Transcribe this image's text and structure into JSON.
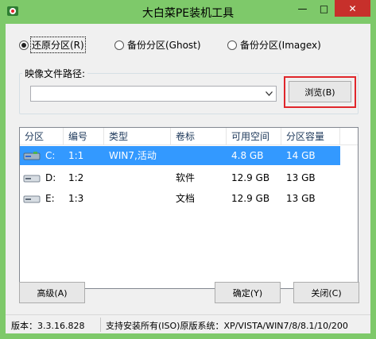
{
  "window": {
    "title": "大白菜PE装机工具",
    "controls": {
      "minimize": "—",
      "maximize": "□",
      "close": "✕"
    }
  },
  "modes": [
    {
      "label": "还原分区(R)",
      "selected": true
    },
    {
      "label": "备份分区(Ghost)",
      "selected": false
    },
    {
      "label": "备份分区(Imagex)",
      "selected": false
    }
  ],
  "image_path": {
    "group_label": "映像文件路径:",
    "value": "",
    "browse_label": "浏览(B)"
  },
  "table": {
    "headers": [
      "分区",
      "编号",
      "类型",
      "卷标",
      "可用空间",
      "分区容量"
    ],
    "rows": [
      {
        "partition": "C:",
        "number": "1:1",
        "type": "WIN7,活动",
        "label": "",
        "free": "4.8 GB",
        "capacity": "14 GB",
        "selected": true
      },
      {
        "partition": "D:",
        "number": "1:2",
        "type": "",
        "label": "软件",
        "free": "12.9 GB",
        "capacity": "13 GB",
        "selected": false
      },
      {
        "partition": "E:",
        "number": "1:3",
        "type": "",
        "label": "文档",
        "free": "12.9 GB",
        "capacity": "13 GB",
        "selected": false
      }
    ]
  },
  "buttons": {
    "advanced": "高级(A)",
    "ok": "确定(Y)",
    "close": "关闭(C)"
  },
  "status": {
    "version": "版本：3.3.16.828",
    "info": "支持安装所有(ISO)原版系统：XP/VISTA/WIN7/8/8.1/10/200"
  },
  "colors": {
    "titlebar": "#7ec96a",
    "close_button": "#c7302b",
    "selection": "#3399ff",
    "highlight": "#e0262b"
  }
}
